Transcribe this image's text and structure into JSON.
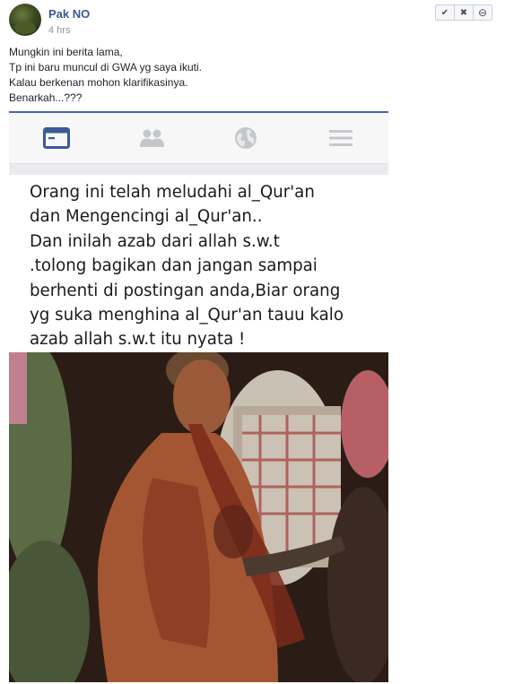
{
  "post": {
    "author": "Pak NO",
    "time": "4 hrs",
    "lines": [
      "Mungkin ini berita lama,",
      "Tp ini baru muncul di GWA yg saya ikuti.",
      "Kalau berkenan mohon klarifikasinya.",
      "Benarkah...???"
    ]
  },
  "moderation": {
    "approve_icon": "check-icon",
    "remove_icon": "x-icon",
    "block_icon": "minus-circle-icon",
    "approve_glyph": "✔",
    "remove_glyph": "✖",
    "block_glyph": "⊖"
  },
  "screenshot": {
    "tabs": [
      "news-feed-icon",
      "friends-icon",
      "globe-icon",
      "menu-icon"
    ],
    "active_tab_color": "#3b5998",
    "inactive_tab_color": "#c4c7cc",
    "quote_lines": [
      "Orang ini telah meludahi al_Qur'an",
      "dan Mengencingi al_Qur'an..",
      "Dan inilah azab dari allah s.w.t",
      ".tolong bagikan dan jangan sampai",
      "berhenti di postingan anda,Biar orang",
      "yg suka menghina al_Qur'an tauu kalo",
      "azab allah s.w.t itu nyata !"
    ]
  }
}
